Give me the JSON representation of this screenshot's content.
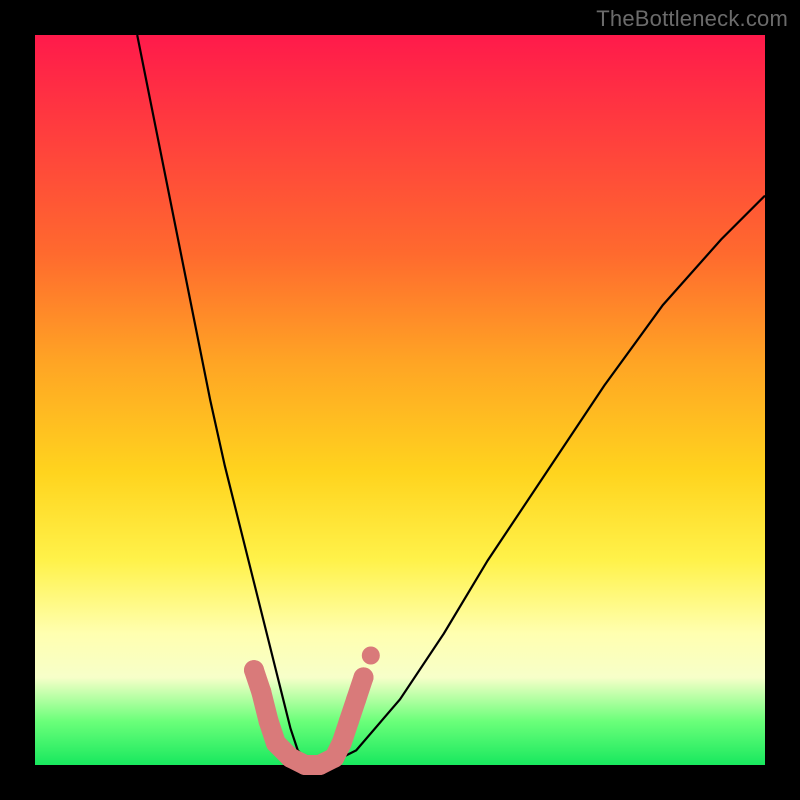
{
  "watermark": "TheBottleneck.com",
  "chart_data": {
    "type": "line",
    "title": "",
    "xlabel": "",
    "ylabel": "",
    "xlim": [
      0,
      100
    ],
    "ylim": [
      0,
      100
    ],
    "grid": false,
    "series": [
      {
        "name": "bottleneck-curve",
        "x": [
          14,
          16,
          18,
          20,
          22,
          24,
          26,
          28,
          30,
          32,
          33,
          34,
          35,
          36,
          38,
          40,
          44,
          50,
          56,
          62,
          70,
          78,
          86,
          94,
          100
        ],
        "y": [
          100,
          90,
          80,
          70,
          60,
          50,
          41,
          33,
          25,
          17,
          13,
          9,
          5,
          2,
          0,
          0,
          2,
          9,
          18,
          28,
          40,
          52,
          63,
          72,
          78
        ]
      }
    ],
    "markers": {
      "name": "trough-blobs",
      "color": "#d97a7a",
      "points": [
        {
          "x": 30,
          "y": 13
        },
        {
          "x": 31,
          "y": 10
        },
        {
          "x": 32,
          "y": 6
        },
        {
          "x": 33,
          "y": 3
        },
        {
          "x": 35,
          "y": 1
        },
        {
          "x": 37,
          "y": 0
        },
        {
          "x": 39,
          "y": 0
        },
        {
          "x": 41,
          "y": 1
        },
        {
          "x": 42,
          "y": 3
        },
        {
          "x": 43,
          "y": 6
        },
        {
          "x": 44,
          "y": 9
        },
        {
          "x": 45,
          "y": 12
        }
      ],
      "isolated_dot": {
        "x": 46,
        "y": 15
      }
    },
    "background_gradient": {
      "direction": "vertical",
      "stops": [
        {
          "pos": 0.0,
          "color": "#ff1a4b"
        },
        {
          "pos": 0.3,
          "color": "#ff6a2e"
        },
        {
          "pos": 0.6,
          "color": "#ffd41e"
        },
        {
          "pos": 0.82,
          "color": "#ffffb0"
        },
        {
          "pos": 1.0,
          "color": "#18e85e"
        }
      ]
    }
  }
}
